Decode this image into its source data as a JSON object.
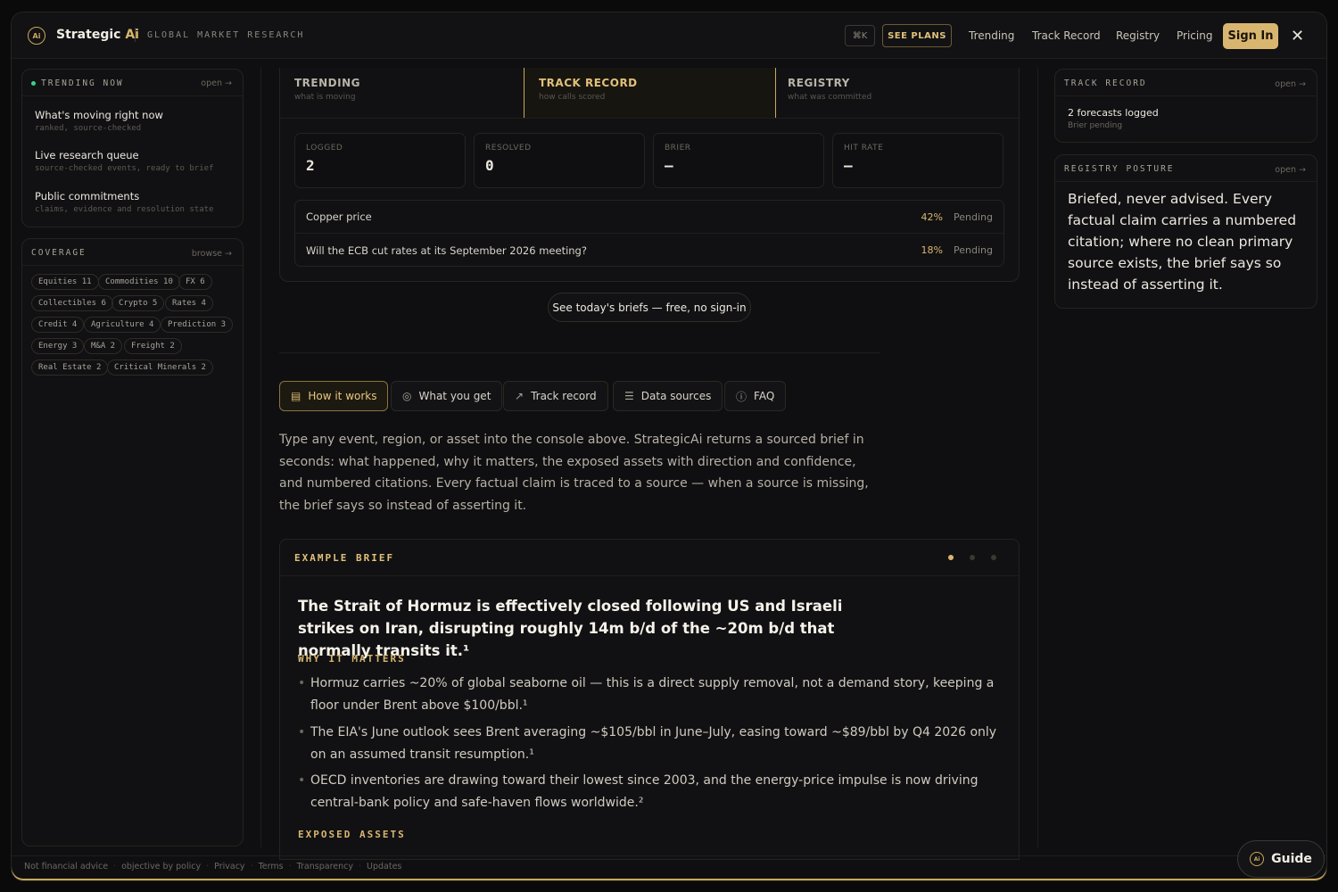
{
  "header": {
    "logo_text": "Ai",
    "brand_name": "Strategic",
    "brand_accent": "Ai",
    "tagline": "GLOBAL MARKET RESEARCH",
    "kbd": "⌘K",
    "see_plans": "SEE PLANS",
    "nav": [
      "Trending",
      "Track Record",
      "Registry",
      "Pricing"
    ],
    "sign_in": "Sign In",
    "close": "✕"
  },
  "trending": {
    "title": "TRENDING NOW",
    "link": "open →",
    "items": [
      {
        "title": "What's moving right now",
        "sub": "ranked, source-checked"
      },
      {
        "title": "Live research queue",
        "sub": "source-checked events, ready to brief"
      },
      {
        "title": "Public commitments",
        "sub": "claims, evidence and resolution state"
      }
    ]
  },
  "coverage": {
    "title": "COVERAGE",
    "link": "browse →",
    "chips": [
      "Equities 11",
      "Commodities 10",
      "FX 6",
      "Collectibles 6",
      "Crypto 5",
      "Rates 4",
      "Credit 4",
      "Agriculture 4",
      "Prediction 3",
      "Energy 3",
      "M&A 2",
      "Freight 2",
      "Real Estate 2",
      "Critical Minerals 2"
    ]
  },
  "tabs": [
    {
      "label": "TRENDING",
      "sub": "what is moving"
    },
    {
      "label": "TRACK RECORD",
      "sub": "how calls scored"
    },
    {
      "label": "REGISTRY",
      "sub": "what was committed"
    }
  ],
  "stats": [
    {
      "label": "LOGGED",
      "value": "2"
    },
    {
      "label": "RESOLVED",
      "value": "0"
    },
    {
      "label": "BRIER",
      "value": "—"
    },
    {
      "label": "HIT RATE",
      "value": "—"
    }
  ],
  "forecasts": [
    {
      "name": "Copper price",
      "pct": "42%",
      "status": "Pending"
    },
    {
      "name": "Will the ECB cut rates at its September 2026 meeting?",
      "pct": "18%",
      "status": "Pending"
    }
  ],
  "today_button": "See today's briefs — free, no sign-in",
  "pills": [
    {
      "label": "How it works",
      "icon": "📄"
    },
    {
      "label": "What you get",
      "icon": "◎"
    },
    {
      "label": "Track record",
      "icon": "↗"
    },
    {
      "label": "Data sources",
      "icon": "☰"
    },
    {
      "label": "FAQ",
      "icon": "ⓘ"
    }
  ],
  "intro": "Type any event, region, or asset into the console above. StrategicAi returns a sourced brief in seconds: what happened, why it matters, the exposed assets with direction and confidence, and numbered citations. Every factual claim is traced to a source — when a source is missing, the brief says so instead of asserting it.",
  "brief": {
    "label": "EXAMPLE BRIEF",
    "headline": "The Strait of Hormuz is effectively closed following US and Israeli strikes on Iran, disrupting roughly 14m b/d of the ~20m b/d that normally transits it.¹",
    "why_title": "WHY IT MATTERS",
    "bullets": [
      "Hormuz carries ~20% of global seaborne oil — this is a direct supply removal, not a demand story, keeping a floor under Brent above $100/bbl.¹",
      "The EIA's June outlook sees Brent averaging ~$105/bbl in June–July, easing toward ~$89/bbl by Q4 2026 only on an assumed transit resumption.¹",
      "OECD inventories are drawing toward their lowest since 2003, and the energy-price impulse is now driving central-bank policy and safe-haven flows worldwide.²"
    ],
    "exposed_title": "EXPOSED ASSETS"
  },
  "track_record": {
    "title": "TRACK RECORD",
    "link": "open →",
    "line": "2 forecasts logged",
    "sub": "Brier pending"
  },
  "registry": {
    "title": "REGISTRY POSTURE",
    "link": "open →",
    "text": "Briefed, never advised. Every factual claim carries a numbered citation; where no clean primary source exists, the brief says so instead of asserting it."
  },
  "footer": [
    "Not financial advice",
    "objective by policy",
    "Privacy",
    "Terms",
    "Transparency",
    "Updates"
  ],
  "guide": "Guide",
  "colors": {
    "accent": "#d9b670",
    "background": "#0f0f11",
    "status_dot": "#3ecf8e"
  }
}
